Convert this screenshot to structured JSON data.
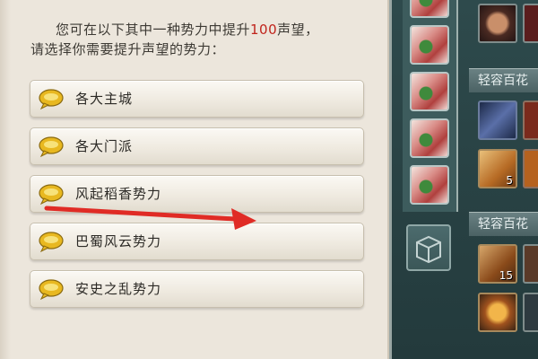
{
  "dialog": {
    "prompt_line1_pre": "您可在以下其中一种势力中提升",
    "prompt_amount": "100",
    "prompt_line1_post": "声望，",
    "prompt_line2": "请选择你需要提升声望的势力：",
    "options": [
      {
        "label": "各大主城"
      },
      {
        "label": "各大门派"
      },
      {
        "label": "风起稻香势力"
      },
      {
        "label": "巴蜀风云势力"
      },
      {
        "label": "安史之乱势力"
      }
    ]
  },
  "inventory": {
    "shelf_labels": [
      "轻容百花",
      "轻容百花"
    ],
    "counts": [
      "5",
      "15"
    ]
  },
  "colors": {
    "highlight": "#c0241c",
    "arrow": "#e02b25",
    "bubble": "#e8b820"
  }
}
